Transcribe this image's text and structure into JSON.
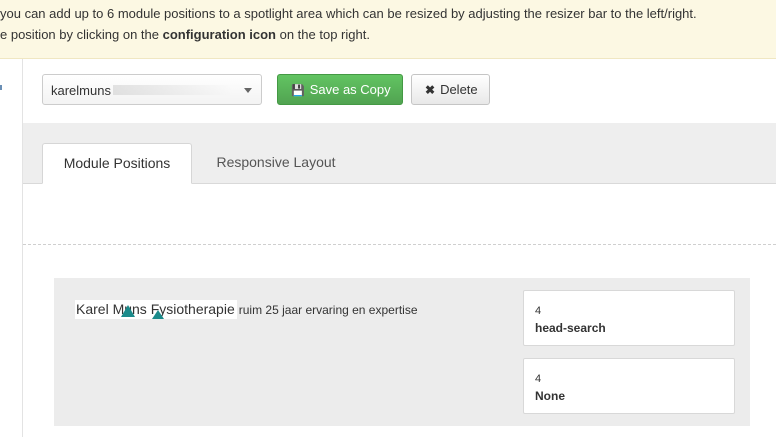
{
  "banner": {
    "line1": "you can add up to 6 module positions to a spotlight area which can be resized by adjusting the resizer bar to the left/right.",
    "line2_prefix": "e position by clicking on the ",
    "line2_bold": "configuration icon",
    "line2_suffix": " on the top right."
  },
  "toolbar": {
    "select_value": "karelmuns",
    "save_copy_label": "Save as Copy",
    "delete_label": "Delete"
  },
  "tabs": [
    {
      "label": "Module Positions",
      "active": true
    },
    {
      "label": "Responsive Layout",
      "active": false
    }
  ],
  "spotlight": {
    "brand_text": "Karel Muns Fysiotherapie",
    "tagline": "ruim 25 jaar ervaring en expertise",
    "positions": [
      {
        "number": "4",
        "name": "head-search"
      },
      {
        "number": "4",
        "name": "None"
      }
    ]
  },
  "colors": {
    "banner_bg": "#fcf8e3",
    "save_button": "#5bb75b",
    "brand_accent": "#1a8a8a"
  }
}
